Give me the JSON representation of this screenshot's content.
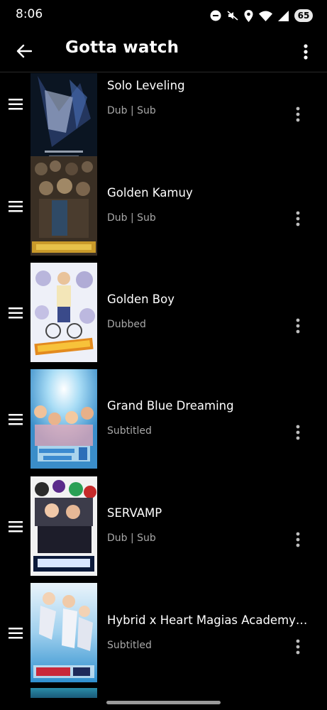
{
  "status_bar": {
    "time": "8:06",
    "battery": "65",
    "icons": [
      "do-not-disturb-icon",
      "mute-icon",
      "location-icon",
      "wifi-icon",
      "signal-icon",
      "battery-icon"
    ]
  },
  "app_bar": {
    "title": "Gotta watch",
    "back_icon": "arrow-back-icon",
    "menu_icon": "more-vert-icon"
  },
  "list": {
    "items": [
      {
        "title": "Solo Leveling",
        "subtitle": "Dub | Sub"
      },
      {
        "title": "Golden Kamuy",
        "subtitle": "Dub | Sub"
      },
      {
        "title": "Golden Boy",
        "subtitle": "Dubbed"
      },
      {
        "title": "Grand Blue Dreaming",
        "subtitle": "Subtitled"
      },
      {
        "title": "SERVAMP",
        "subtitle": "Dub | Sub"
      },
      {
        "title": "Hybrid x Heart Magias Academy At...",
        "subtitle": "Subtitled"
      }
    ]
  },
  "colors": {
    "background": "#000000",
    "text_primary": "#ffffff",
    "text_secondary": "#a8a8a8"
  }
}
